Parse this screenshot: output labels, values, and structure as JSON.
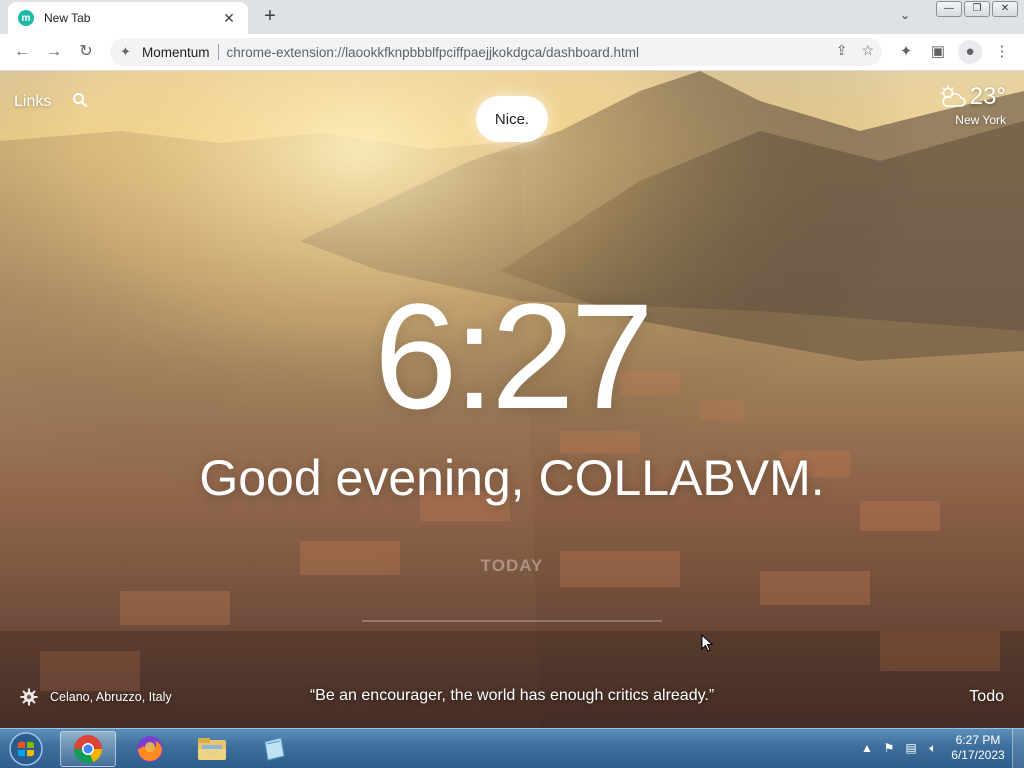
{
  "browser": {
    "tab_title": "New Tab",
    "tab_favicon_letter": "m",
    "new_tab_label": "+",
    "window_controls": {
      "minimize": "—",
      "restore": "❐",
      "close": "✕"
    }
  },
  "toolbar": {
    "extension_name": "Momentum",
    "url": "chrome-extension://laookkfknpbbblfpciffpaejjkokdgca/dashboard.html"
  },
  "dashboard": {
    "links_label": "Links",
    "mantra": "Nice.",
    "weather": {
      "temperature": "23°",
      "location": "New York",
      "icon": "partly-cloudy-icon"
    },
    "clock": "6:27",
    "greeting": "Good evening, COLLABVM.",
    "focus_heading": "TODAY",
    "photo_location": "Celano, Abruzzo, Italy",
    "quote": "“Be an encourager, the world has enough critics already.”",
    "todo_label": "Todo"
  },
  "taskbar": {
    "time": "6:27 PM",
    "date": "6/17/2023",
    "apps": [
      "chrome",
      "firefox",
      "file-explorer",
      "notepad"
    ]
  },
  "colors": {
    "chrome_tabstrip": "#dee1e6",
    "momentum_accent": "#1eb8a6",
    "taskbar": "#3e6f9c"
  }
}
